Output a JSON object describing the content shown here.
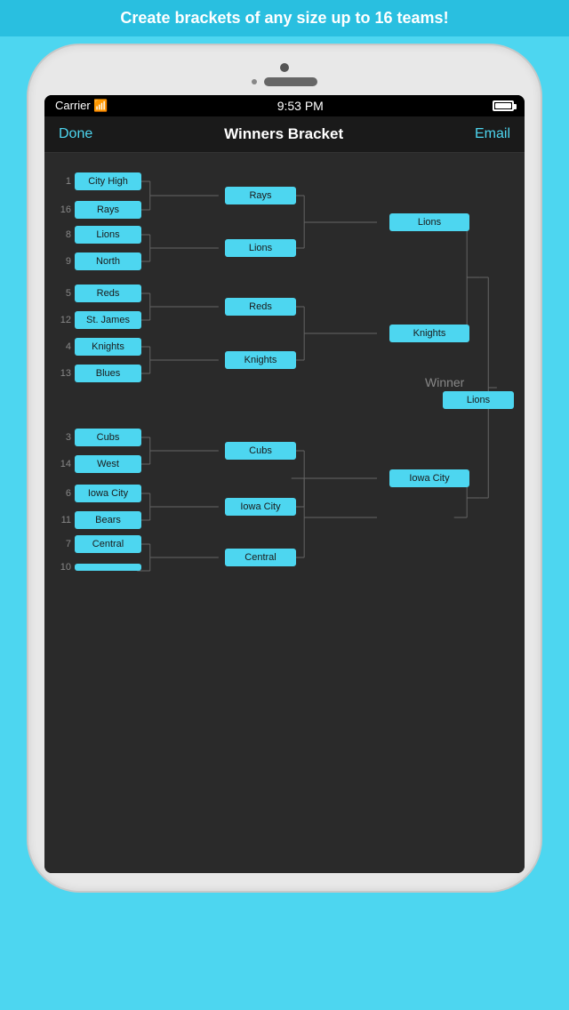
{
  "promo": {
    "text": "Create brackets of any size up to 16 teams!"
  },
  "statusBar": {
    "carrier": "Carrier",
    "time": "9:53 PM"
  },
  "navBar": {
    "done": "Done",
    "title": "Winners Bracket",
    "email": "Email"
  },
  "bracket": {
    "round1": [
      {
        "seed": "1",
        "name": "City High"
      },
      {
        "seed": "16",
        "name": "Rays"
      },
      {
        "seed": "8",
        "name": "Lions"
      },
      {
        "seed": "9",
        "name": "North"
      },
      {
        "seed": "5",
        "name": "Reds"
      },
      {
        "seed": "12",
        "name": "St. James"
      },
      {
        "seed": "4",
        "name": "Knights"
      },
      {
        "seed": "13",
        "name": "Blues"
      },
      {
        "seed": "3",
        "name": "Cubs"
      },
      {
        "seed": "14",
        "name": "West"
      },
      {
        "seed": "6",
        "name": "Iowa City"
      },
      {
        "seed": "11",
        "name": "Bears"
      },
      {
        "seed": "7",
        "name": "Central"
      },
      {
        "seed": "10",
        "name": ""
      }
    ],
    "round2": [
      {
        "name": "Rays"
      },
      {
        "name": "Lions"
      },
      {
        "name": "Reds"
      },
      {
        "name": "Knights"
      },
      {
        "name": "Cubs"
      },
      {
        "name": "Iowa City"
      },
      {
        "name": "Central"
      }
    ],
    "round3": [
      {
        "name": "Lions"
      },
      {
        "name": "Knights"
      },
      {
        "name": "Iowa City"
      }
    ],
    "round4": [
      {
        "name": "Lions"
      },
      {
        "name": "Iowa City"
      }
    ],
    "winner": {
      "label": "Winner",
      "name": "Lions"
    }
  }
}
